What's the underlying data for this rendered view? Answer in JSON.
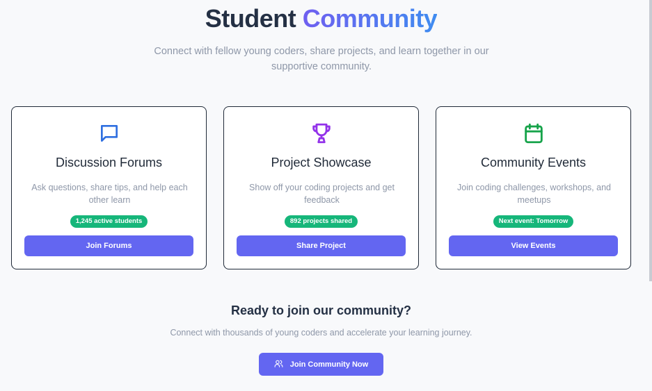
{
  "hero": {
    "title_part1": "Student",
    "title_part2": "Community",
    "subtitle": "Connect with fellow young coders, share projects, and learn together in our supportive community."
  },
  "cards": [
    {
      "icon": "chat-bubble-icon",
      "icon_color": "#2f6fe0",
      "title": "Discussion Forums",
      "description": "Ask questions, share tips, and help each other learn",
      "badge": "1,245 active students",
      "button": "Join Forums"
    },
    {
      "icon": "trophy-icon",
      "icon_color": "#9333ea",
      "title": "Project Showcase",
      "description": "Show off your coding projects and get feedback",
      "badge": "892 projects shared",
      "button": "Share Project"
    },
    {
      "icon": "calendar-icon",
      "icon_color": "#16a34a",
      "title": "Community Events",
      "description": "Join coding challenges, workshops, and meetups",
      "badge": "Next event: Tomorrow",
      "button": "View Events"
    }
  ],
  "cta": {
    "title": "Ready to join our community?",
    "subtitle": "Connect with thousands of young coders and accelerate your learning journey.",
    "button": "Join Community Now",
    "button_icon": "users-icon"
  },
  "colors": {
    "accent": "#6366f1",
    "badge": "#16b67a"
  }
}
